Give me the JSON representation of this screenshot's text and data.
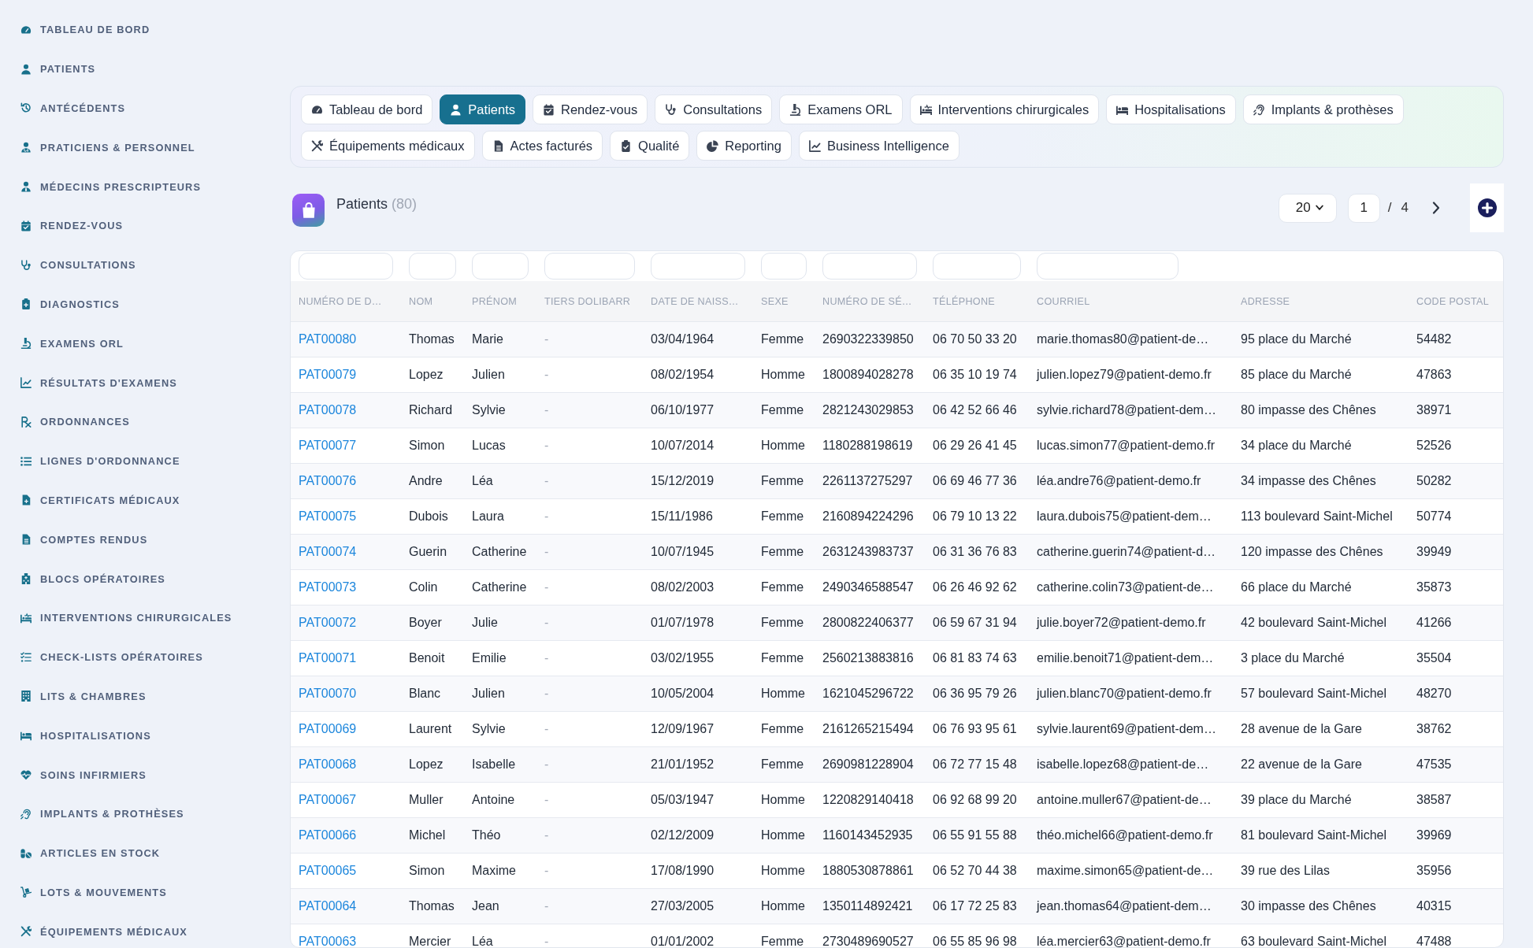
{
  "sidebar": {
    "items": [
      {
        "label": "TABLEAU DE BORD"
      },
      {
        "label": "PATIENTS"
      },
      {
        "label": "ANTÉCÉDENTS"
      },
      {
        "label": "PRATICIENS & PERSONNEL"
      },
      {
        "label": "MÉDECINS PRESCRIPTEURS"
      },
      {
        "label": "RENDEZ-VOUS"
      },
      {
        "label": "CONSULTATIONS"
      },
      {
        "label": "DIAGNOSTICS"
      },
      {
        "label": "EXAMENS ORL"
      },
      {
        "label": "RÉSULTATS D'EXAMENS"
      },
      {
        "label": "ORDONNANCES"
      },
      {
        "label": "LIGNES D'ORDONNANCE"
      },
      {
        "label": "CERTIFICATS MÉDICAUX"
      },
      {
        "label": "COMPTES RENDUS"
      },
      {
        "label": "BLOCS OPÉRATOIRES"
      },
      {
        "label": "INTERVENTIONS CHIRURGICALES"
      },
      {
        "label": "CHECK-LISTS OPÉRATOIRES"
      },
      {
        "label": "LITS & CHAMBRES"
      },
      {
        "label": "HOSPITALISATIONS"
      },
      {
        "label": "SOINS INFIRMIERS"
      },
      {
        "label": "IMPLANTS & PROTHÈSES"
      },
      {
        "label": "ARTICLES EN STOCK"
      },
      {
        "label": "LOTS & MOUVEMENTS"
      },
      {
        "label": "ÉQUIPEMENTS MÉDICAUX"
      }
    ]
  },
  "tabs": [
    {
      "label": "Tableau de bord",
      "selected": false
    },
    {
      "label": "Patients",
      "selected": true
    },
    {
      "label": "Rendez-vous",
      "selected": false
    },
    {
      "label": "Consultations",
      "selected": false
    },
    {
      "label": "Examens ORL",
      "selected": false
    },
    {
      "label": "Interventions chirurgicales",
      "selected": false
    },
    {
      "label": "Hospitalisations",
      "selected": false
    },
    {
      "label": "Implants & prothèses",
      "selected": false
    },
    {
      "label": "Équipements médicaux",
      "selected": false
    },
    {
      "label": "Actes facturés",
      "selected": false
    },
    {
      "label": "Qualité",
      "selected": false
    },
    {
      "label": "Reporting",
      "selected": false
    },
    {
      "label": "Business Intelligence",
      "selected": false
    }
  ],
  "page_header": {
    "title": "Patients",
    "count": "(80)"
  },
  "pagination": {
    "page_size": "20",
    "page": "1",
    "separator": "/",
    "total_pages": "4"
  },
  "table": {
    "columns": [
      {
        "label": "NUMÉRO DE D…",
        "filterable": true,
        "kind": "link"
      },
      {
        "label": "NOM",
        "filterable": true,
        "kind": "text"
      },
      {
        "label": "PRÉNOM",
        "filterable": true,
        "kind": "text"
      },
      {
        "label": "TIERS DOLIBARR",
        "filterable": true,
        "kind": "muted"
      },
      {
        "label": "DATE DE NAISS…",
        "filterable": true,
        "kind": "text"
      },
      {
        "label": "SEXE",
        "filterable": true,
        "kind": "text"
      },
      {
        "label": "NUMÉRO DE SÉ…",
        "filterable": true,
        "kind": "text"
      },
      {
        "label": "TÉLÉPHONE",
        "filterable": true,
        "kind": "text"
      },
      {
        "label": "COURRIEL",
        "filterable": true,
        "kind": "text"
      },
      {
        "label": "ADRESSE",
        "filterable": false,
        "kind": "text"
      },
      {
        "label": "CODE POSTAL",
        "filterable": false,
        "kind": "text"
      }
    ],
    "rows": [
      [
        "PAT00080",
        "Thomas",
        "Marie",
        "-",
        "03/04/1964",
        "Femme",
        "2690322339850",
        "06 70 50 33 20",
        "marie.thomas80@patient-de…",
        "95 place du Marché",
        "54482"
      ],
      [
        "PAT00079",
        "Lopez",
        "Julien",
        "-",
        "08/02/1954",
        "Homme",
        "1800894028278",
        "06 35 10 19 74",
        "julien.lopez79@patient-demo.fr",
        "85 place du Marché",
        "47863"
      ],
      [
        "PAT00078",
        "Richard",
        "Sylvie",
        "-",
        "06/10/1977",
        "Femme",
        "2821243029853",
        "06 42 52 66 46",
        "sylvie.richard78@patient-dem…",
        "80 impasse des Chênes",
        "38971"
      ],
      [
        "PAT00077",
        "Simon",
        "Lucas",
        "-",
        "10/07/2014",
        "Homme",
        "1180288198619",
        "06 29 26 41 45",
        "lucas.simon77@patient-demo.fr",
        "34 place du Marché",
        "52526"
      ],
      [
        "PAT00076",
        "Andre",
        "Léa",
        "-",
        "15/12/2019",
        "Femme",
        "2261137275297",
        "06 69 46 77 36",
        "léa.andre76@patient-demo.fr",
        "34 impasse des Chênes",
        "50282"
      ],
      [
        "PAT00075",
        "Dubois",
        "Laura",
        "-",
        "15/11/1986",
        "Femme",
        "2160894224296",
        "06 79 10 13 22",
        "laura.dubois75@patient-dem…",
        "113 boulevard Saint-Michel",
        "50774"
      ],
      [
        "PAT00074",
        "Guerin",
        "Catherine",
        "-",
        "10/07/1945",
        "Femme",
        "2631243983737",
        "06 31 36 76 83",
        "catherine.guerin74@patient-d…",
        "120 impasse des Chênes",
        "39949"
      ],
      [
        "PAT00073",
        "Colin",
        "Catherine",
        "-",
        "08/02/2003",
        "Femme",
        "2490346588547",
        "06 26 46 92 62",
        "catherine.colin73@patient-de…",
        "66 place du Marché",
        "35873"
      ],
      [
        "PAT00072",
        "Boyer",
        "Julie",
        "-",
        "01/07/1978",
        "Femme",
        "2800822406377",
        "06 59 67 31 94",
        "julie.boyer72@patient-demo.fr",
        "42 boulevard Saint-Michel",
        "41266"
      ],
      [
        "PAT00071",
        "Benoit",
        "Emilie",
        "-",
        "03/02/1955",
        "Femme",
        "2560213883816",
        "06 81 83 74 63",
        "emilie.benoit71@patient-dem…",
        "3 place du Marché",
        "35504"
      ],
      [
        "PAT00070",
        "Blanc",
        "Julien",
        "-",
        "10/05/2004",
        "Homme",
        "1621045296722",
        "06 36 95 79 26",
        "julien.blanc70@patient-demo.fr",
        "57 boulevard Saint-Michel",
        "48270"
      ],
      [
        "PAT00069",
        "Laurent",
        "Sylvie",
        "-",
        "12/09/1967",
        "Femme",
        "2161265215494",
        "06 76 93 95 61",
        "sylvie.laurent69@patient-dem…",
        "28 avenue de la Gare",
        "38762"
      ],
      [
        "PAT00068",
        "Lopez",
        "Isabelle",
        "-",
        "21/01/1952",
        "Femme",
        "2690981228904",
        "06 72 77 15 48",
        "isabelle.lopez68@patient-de…",
        "22 avenue de la Gare",
        "47535"
      ],
      [
        "PAT00067",
        "Muller",
        "Antoine",
        "-",
        "05/03/1947",
        "Homme",
        "1220829140418",
        "06 92 68 99 20",
        "antoine.muller67@patient-de…",
        "39 place du Marché",
        "38587"
      ],
      [
        "PAT00066",
        "Michel",
        "Théo",
        "-",
        "02/12/2009",
        "Homme",
        "1160143452935",
        "06 55 91 55 88",
        "théo.michel66@patient-demo.fr",
        "81 boulevard Saint-Michel",
        "39969"
      ],
      [
        "PAT00065",
        "Simon",
        "Maxime",
        "-",
        "17/08/1990",
        "Homme",
        "1880530878861",
        "06 52 70 44 38",
        "maxime.simon65@patient-de…",
        "39 rue des Lilas",
        "35956"
      ],
      [
        "PAT00064",
        "Thomas",
        "Jean",
        "-",
        "27/03/2005",
        "Homme",
        "1350114892421",
        "06 17 72 25 83",
        "jean.thomas64@patient-dem…",
        "30 impasse des Chênes",
        "40315"
      ],
      [
        "PAT00063",
        "Mercier",
        "Léa",
        "-",
        "01/01/2002",
        "Femme",
        "2730489690527",
        "06 55 85 96 98",
        "léa.mercier63@patient-demo.fr",
        "63 boulevard Saint-Michel",
        "47488"
      ]
    ]
  }
}
